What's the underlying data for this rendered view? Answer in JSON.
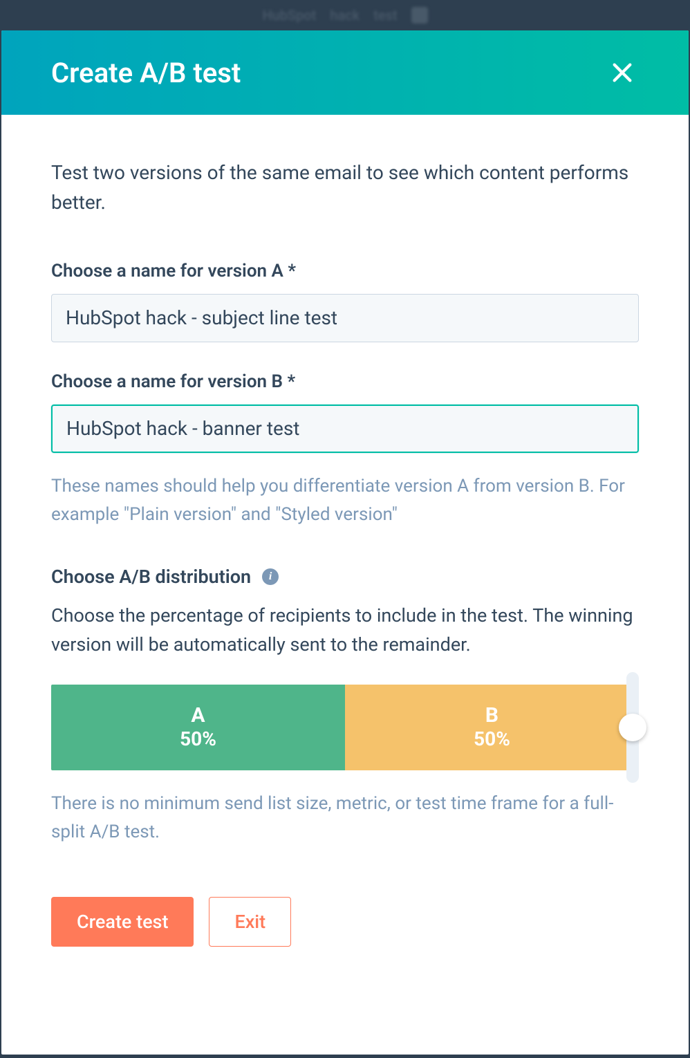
{
  "backdrop": {
    "word1": "HubSpot",
    "word2": "hack",
    "word3": "test"
  },
  "modal": {
    "title": "Create A/B test",
    "intro": "Test two versions of the same email to see which content performs better.",
    "fieldA": {
      "label": "Choose a name for version A *",
      "value": "HubSpot hack - subject line test"
    },
    "fieldB": {
      "label": "Choose a name for version B *",
      "value": "HubSpot hack - banner test"
    },
    "namesHelp": "These names should help you differentiate version A from version B. For example \"Plain version\" and \"Styled version\"",
    "distribution": {
      "heading": "Choose A/B distribution",
      "description": "Choose the percentage of recipients to include in the test. The winning version will be automatically sent to the remainder.",
      "segA": {
        "label": "A",
        "pct": "50%"
      },
      "segB": {
        "label": "B",
        "pct": "50%"
      },
      "note": "There is no minimum send list size, metric, or test time frame for a full-split A/B test."
    },
    "actions": {
      "primary": "Create test",
      "secondary": "Exit"
    }
  }
}
